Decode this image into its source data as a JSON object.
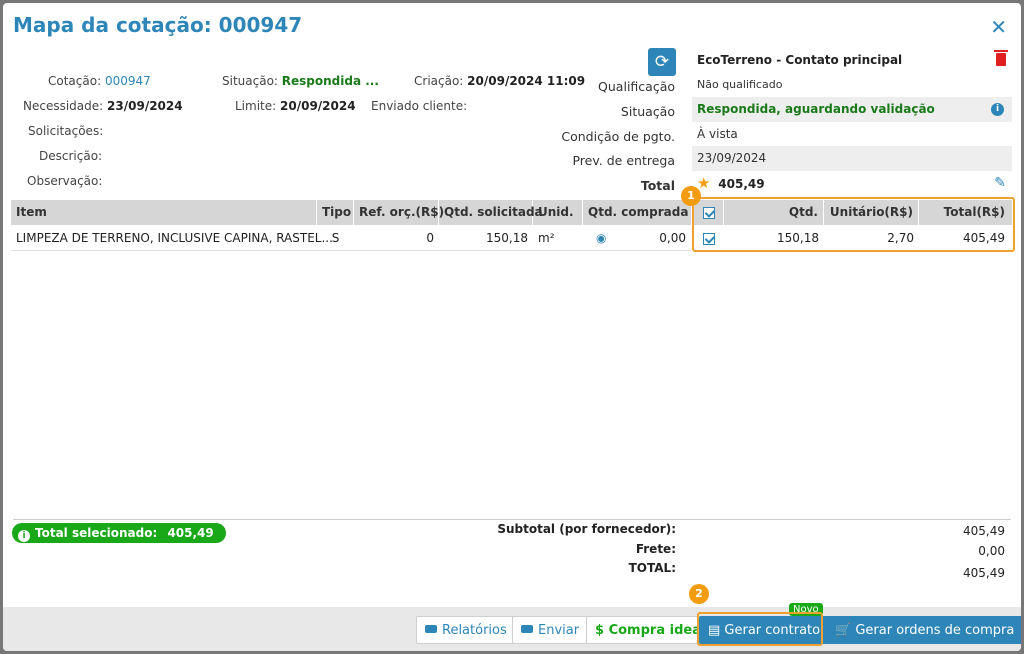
{
  "header": {
    "title": "Mapa da cotação: 000947"
  },
  "info": {
    "cotacao_label": "Cotação:",
    "cotacao_value": "000947",
    "situacao_label": "Situação:",
    "situacao_value": "Respondida ...",
    "criacao_label": "Criação:",
    "criacao_value": "20/09/2024 11:09",
    "necessidade_label": "Necessidade:",
    "necessidade_value": "23/09/2024",
    "limite_label": "Limite:",
    "limite_value": "20/09/2024",
    "enviado_label": "Enviado cliente:",
    "solicitacoes_label": "Solicitações:",
    "descricao_label": "Descrição:",
    "observacao_label": "Observação:"
  },
  "supplier_labels": {
    "qualificacao": "Qualificação",
    "situacao": "Situação",
    "condicao": "Condição de pgto.",
    "prev_entrega": "Prev. de entrega",
    "total": "Total"
  },
  "supplier": {
    "name": "EcoTerreno - Contato principal",
    "qualificacao": "Não qualificado",
    "situacao": "Respondida, aguardando validação",
    "condicao": "À vista",
    "prev_entrega": "23/09/2024",
    "total": "405,49"
  },
  "table": {
    "headers": [
      "Item",
      "Tipo",
      "Ref. orç.(R$)",
      "Qtd. solicitada",
      "Unid.",
      "Qtd. comprada"
    ],
    "row": {
      "item": "LIMPEZA DE TERRENO, INCLUSIVE CAPINA, RASTEL...",
      "tipo": "S",
      "ref": "0",
      "qtd_sol": "150,18",
      "unid": "m²",
      "qtd_comp": "0,00"
    }
  },
  "supplier_table": {
    "headers": [
      "Qtd.",
      "Unitário(R$)",
      "Total(R$)"
    ],
    "row": {
      "qtd": "150,18",
      "unitario": "2,70",
      "total": "405,49"
    }
  },
  "markers": {
    "one": "1",
    "two": "2"
  },
  "summary": {
    "total_sel_label": "Total selecionado:",
    "total_sel_value": "405,49",
    "subtotal_label": "Subtotal (por fornecedor):",
    "subtotal_value": "405,49",
    "frete_label": "Frete:",
    "frete_value": "0,00",
    "total_label": "TOTAL:",
    "total_value": "405,49"
  },
  "footer": {
    "relatorios": "Relatórios",
    "enviar": "Enviar",
    "compra_ideal": "Compra ideal",
    "gerar_contrato": "Gerar contrato",
    "novo": "Novo",
    "gerar_ordens": "Gerar ordens de compra"
  },
  "colors": {
    "accent": "#2e86b8",
    "highlight": "#f0a030",
    "success": "#18a818",
    "danger": "#e02020"
  }
}
